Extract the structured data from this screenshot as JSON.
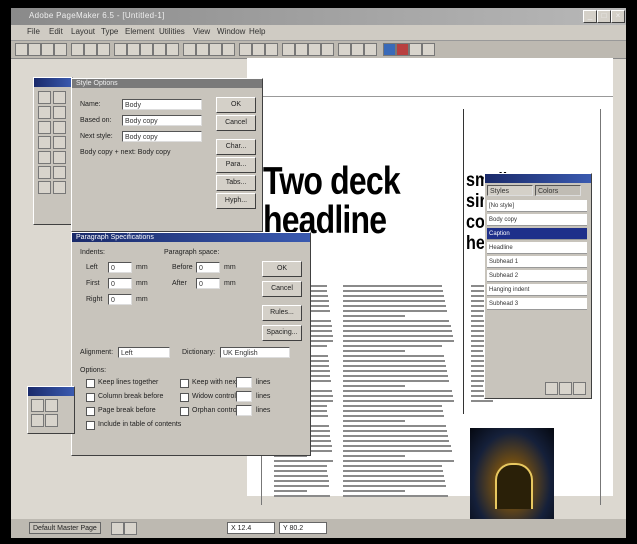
{
  "window": {
    "title": "Adobe PageMaker 6.5 - [Untitled-1]",
    "controls": [
      "_",
      "□",
      "×"
    ]
  },
  "menubar": {
    "items": [
      "File",
      "Edit",
      "Layout",
      "Type",
      "Element",
      "Utilities",
      "View",
      "Window",
      "Help"
    ]
  },
  "page": {
    "headline_line1": "Two deck",
    "headline_line2": "headline",
    "side_headline": [
      "smaller",
      "single",
      "column",
      "head"
    ]
  },
  "style_options_dialog": {
    "title": "Style Options",
    "name_label": "Name:",
    "name_value": "Body",
    "based_on_label": "Based on:",
    "based_on_value": "Body copy",
    "next_style_label": "Next style:",
    "next_style_value": "Body copy",
    "description": "Body copy + next: Body copy",
    "buttons": [
      "OK",
      "Cancel",
      "Char...",
      "Para...",
      "Tabs...",
      "Hyph..."
    ]
  },
  "paragraph_dialog": {
    "title": "Paragraph Specifications",
    "indents_label": "Indents:",
    "left_label": "Left",
    "first_label": "First",
    "right_label": "Right",
    "left_value": "0",
    "first_value": "0",
    "right_value": "0",
    "unit": "mm",
    "space_label": "Paragraph space:",
    "before_label": "Before",
    "after_label": "After",
    "before_value": "0",
    "after_value": "0",
    "alignment_label": "Alignment:",
    "alignment_value": "Left",
    "dictionary_label": "Dictionary:",
    "dictionary_value": "UK English",
    "options_label": "Options:",
    "options": [
      "Keep lines together",
      "Column break before",
      "Page break before",
      "Include in table of contents"
    ],
    "options2": [
      "Keep with next",
      "Widow control",
      "Orphan control"
    ],
    "options2_unit": "lines",
    "buttons": [
      "OK",
      "Cancel",
      "Rules...",
      "Spacing..."
    ]
  },
  "styles_palette": {
    "tabs": [
      "Styles",
      "Colors"
    ],
    "items": [
      "[No style]",
      "Body copy",
      "Caption",
      "Headline",
      "Subhead 1",
      "Subhead 2",
      "Hanging indent",
      "Subhead 3"
    ],
    "selected_index": 2
  },
  "statusbar": {
    "layer_label": "Default  Master Page",
    "coordinate_x": "X 12.4",
    "coordinate_y": "Y 80.2"
  },
  "colors": {
    "selection": "#1e2f8a",
    "title_active": "#2a3f8f"
  }
}
